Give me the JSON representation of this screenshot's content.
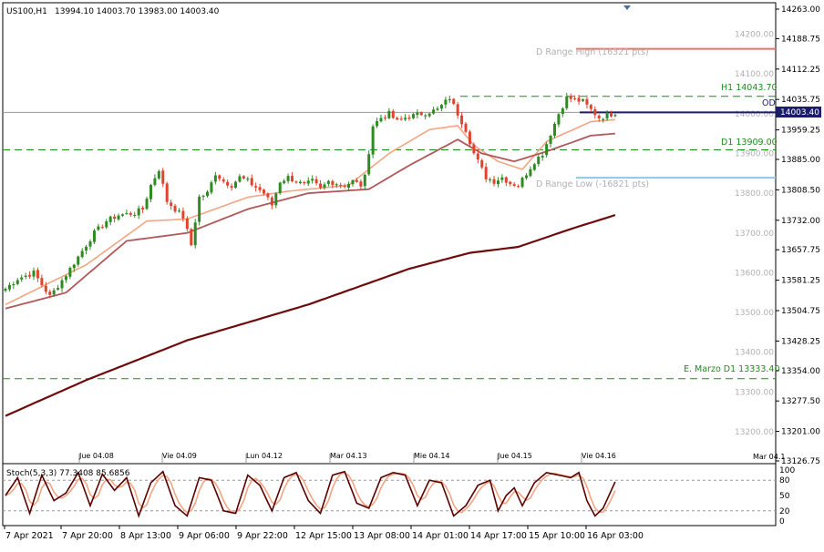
{
  "header": {
    "symbol": "US100,H1",
    "ohlc": "13994.10 14003.70 13983.00 14003.40"
  },
  "colors": {
    "bull": "#2e8b22",
    "bear": "#e0442e",
    "ema_fast": "#f4a582",
    "ema_mid": "#b2575a",
    "ema_slow": "#6e0b0b",
    "level_green": "#1f8a1f",
    "range_high": "#e8736b",
    "range_low": "#8dc6e6",
    "current": "#1c1c6e",
    "stoch_main": "#5a0000",
    "stoch_signal": "#f4a582"
  },
  "price_axis": {
    "labels": [
      "14263.00",
      "14188.75",
      "14112.25",
      "14035.75",
      "13959.25",
      "13885.00",
      "13808.50",
      "13732.00",
      "13657.75",
      "13581.25",
      "13504.75",
      "13428.25",
      "13354.00",
      "13277.50",
      "13201.00",
      "13126.75"
    ],
    "ghost_labels": [
      "14200.00",
      "14100.00",
      "14000.00",
      "13900.00",
      "13800.00",
      "13700.00",
      "13600.00",
      "13500.00",
      "13400.00",
      "13300.00",
      "13200.00"
    ],
    "current_price": "14003.40"
  },
  "levels": {
    "range_high": "D Range High (16321 pts)",
    "h1": "H1 14043.70",
    "od": "OD",
    "d1": "D1 13909.00",
    "range_low": "D Range Low (-16821 pts)",
    "emarzo": "E. Marzo D1 13333.40",
    "values": {
      "range_high": 14163.0,
      "h1": 14043.7,
      "od": 14003.4,
      "d1": 13909.0,
      "range_low": 13839.0,
      "emarzo": 13333.4
    }
  },
  "date_marks": [
    "Jue 04.08",
    "Vie 04.09",
    "Lun 04.12",
    "Mar 04.13",
    "Mie 04.14",
    "Jue 04.15",
    "Vie 04.16"
  ],
  "x_axis": {
    "labels": [
      "7 Apr 2021",
      "7 Apr 20:00",
      "8 Apr 13:00",
      "9 Apr 06:00",
      "9 Apr 22:00",
      "12 Apr 15:00",
      "13 Apr 08:00",
      "14 Apr 01:00",
      "14 Apr 17:00",
      "15 Apr 10:00",
      "16 Apr 03:00"
    ],
    "corner": "Mar 04.1"
  },
  "stoch": {
    "label": "Stoch(5,3,3) 77.3408 85.6856",
    "axis": [
      "100",
      "80",
      "50",
      "20",
      "0"
    ]
  },
  "chart_data": {
    "type": "candlestick",
    "title": "US100,H1",
    "y_range": [
      13126.75,
      14263.0
    ],
    "anchors": [
      [
        0,
        13560
      ],
      [
        3,
        13585
      ],
      [
        7,
        13600
      ],
      [
        11,
        13540
      ],
      [
        15,
        13595
      ],
      [
        18,
        13640
      ],
      [
        22,
        13700
      ],
      [
        25,
        13730
      ],
      [
        28,
        13745
      ],
      [
        32,
        13750
      ],
      [
        34,
        13760
      ],
      [
        36,
        13820
      ],
      [
        38,
        13860
      ],
      [
        40,
        13780
      ],
      [
        42,
        13760
      ],
      [
        44,
        13740
      ],
      [
        46,
        13670
      ],
      [
        48,
        13790
      ],
      [
        50,
        13800
      ],
      [
        52,
        13850
      ],
      [
        54,
        13830
      ],
      [
        56,
        13820
      ],
      [
        58,
        13840
      ],
      [
        60,
        13830
      ],
      [
        62,
        13815
      ],
      [
        64,
        13800
      ],
      [
        66,
        13770
      ],
      [
        68,
        13830
      ],
      [
        70,
        13840
      ],
      [
        72,
        13830
      ],
      [
        74,
        13820
      ],
      [
        76,
        13830
      ],
      [
        78,
        13810
      ],
      [
        80,
        13830
      ],
      [
        82,
        13825
      ],
      [
        84,
        13820
      ],
      [
        86,
        13830
      ],
      [
        88,
        13820
      ],
      [
        89,
        13840
      ],
      [
        91,
        13970
      ],
      [
        93,
        13990
      ],
      [
        95,
        14000
      ],
      [
        97,
        13980
      ],
      [
        99,
        13990
      ],
      [
        101,
        13995
      ],
      [
        103,
        14000
      ],
      [
        105,
        14005
      ],
      [
        107,
        14010
      ],
      [
        110,
        14040
      ],
      [
        112,
        14000
      ],
      [
        114,
        13960
      ],
      [
        116,
        13900
      ],
      [
        118,
        13860
      ],
      [
        119,
        13840
      ],
      [
        121,
        13830
      ],
      [
        123,
        13840
      ],
      [
        125,
        13825
      ],
      [
        127,
        13820
      ],
      [
        129,
        13850
      ],
      [
        131,
        13880
      ],
      [
        133,
        13900
      ],
      [
        135,
        13950
      ],
      [
        137,
        14000
      ],
      [
        139,
        14040
      ],
      [
        141,
        14035
      ],
      [
        143,
        14030
      ],
      [
        145,
        14010
      ],
      [
        147,
        13990
      ],
      [
        149,
        13995
      ],
      [
        151,
        14003
      ]
    ],
    "series": [
      {
        "name": "EMA fast",
        "points": [
          [
            0,
            13520
          ],
          [
            20,
            13620
          ],
          [
            35,
            13730
          ],
          [
            45,
            13735
          ],
          [
            60,
            13790
          ],
          [
            70,
            13805
          ],
          [
            85,
            13820
          ],
          [
            95,
            13900
          ],
          [
            105,
            13960
          ],
          [
            112,
            13970
          ],
          [
            116,
            13920
          ],
          [
            122,
            13880
          ],
          [
            128,
            13860
          ],
          [
            134,
            13930
          ],
          [
            145,
            13980
          ],
          [
            151,
            13985
          ]
        ]
      },
      {
        "name": "EMA mid",
        "points": [
          [
            0,
            13510
          ],
          [
            15,
            13550
          ],
          [
            30,
            13680
          ],
          [
            45,
            13700
          ],
          [
            60,
            13760
          ],
          [
            75,
            13800
          ],
          [
            90,
            13810
          ],
          [
            100,
            13870
          ],
          [
            112,
            13935
          ],
          [
            118,
            13900
          ],
          [
            126,
            13880
          ],
          [
            134,
            13905
          ],
          [
            145,
            13945
          ],
          [
            151,
            13950
          ]
        ]
      },
      {
        "name": "EMA slow",
        "points": [
          [
            0,
            13240
          ],
          [
            20,
            13330
          ],
          [
            45,
            13430
          ],
          [
            75,
            13520
          ],
          [
            100,
            13610
          ],
          [
            115,
            13650
          ],
          [
            127,
            13665
          ],
          [
            140,
            13710
          ],
          [
            151,
            13745
          ]
        ]
      }
    ],
    "stochastic": {
      "name": "Stoch(5,3,3)",
      "main": 77.3408,
      "signal": 85.6856,
      "main_points": [
        [
          0,
          50
        ],
        [
          3,
          85
        ],
        [
          6,
          15
        ],
        [
          9,
          90
        ],
        [
          12,
          40
        ],
        [
          15,
          55
        ],
        [
          18,
          95
        ],
        [
          21,
          30
        ],
        [
          24,
          92
        ],
        [
          27,
          60
        ],
        [
          30,
          85
        ],
        [
          33,
          10
        ],
        [
          36,
          75
        ],
        [
          39,
          97
        ],
        [
          42,
          30
        ],
        [
          45,
          10
        ],
        [
          48,
          85
        ],
        [
          51,
          80
        ],
        [
          54,
          20
        ],
        [
          57,
          15
        ],
        [
          60,
          90
        ],
        [
          63,
          70
        ],
        [
          66,
          20
        ],
        [
          69,
          85
        ],
        [
          72,
          95
        ],
        [
          75,
          40
        ],
        [
          78,
          15
        ],
        [
          81,
          90
        ],
        [
          84,
          97
        ],
        [
          87,
          35
        ],
        [
          90,
          25
        ],
        [
          93,
          85
        ],
        [
          96,
          95
        ],
        [
          99,
          90
        ],
        [
          102,
          30
        ],
        [
          105,
          80
        ],
        [
          108,
          75
        ],
        [
          111,
          10
        ],
        [
          114,
          30
        ],
        [
          117,
          70
        ],
        [
          120,
          80
        ],
        [
          122,
          20
        ],
        [
          124,
          50
        ],
        [
          126,
          65
        ],
        [
          128,
          30
        ],
        [
          131,
          75
        ],
        [
          134,
          95
        ],
        [
          137,
          90
        ],
        [
          140,
          85
        ],
        [
          142,
          95
        ],
        [
          144,
          40
        ],
        [
          146,
          10
        ],
        [
          148,
          25
        ],
        [
          151,
          77
        ]
      ]
    }
  }
}
